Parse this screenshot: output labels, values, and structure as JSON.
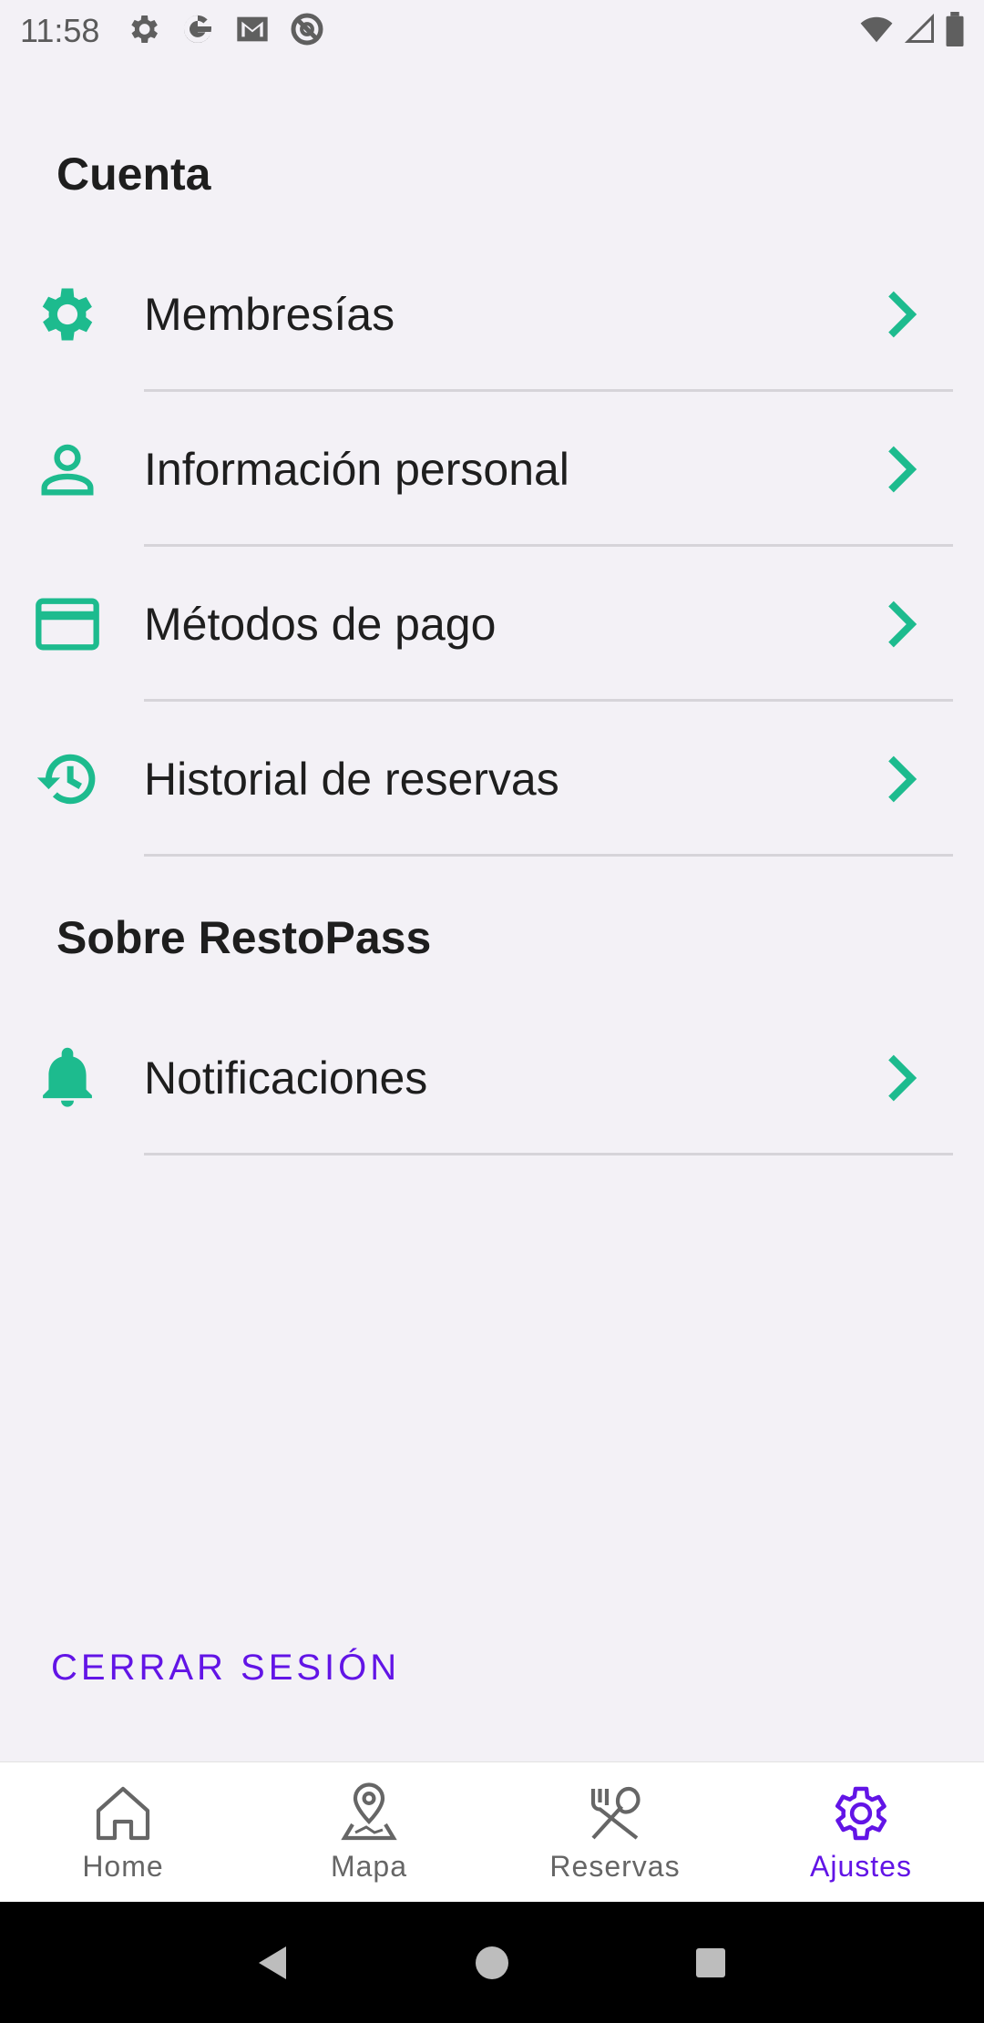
{
  "status_bar": {
    "time": "11:58",
    "left_icons": [
      "settings-icon",
      "google-icon",
      "gmail-icon",
      "at-sign-icon"
    ],
    "right_icons": [
      "wifi-icon",
      "signal-icon",
      "battery-icon"
    ]
  },
  "sections": {
    "account_title": "Cuenta",
    "about_title": "Sobre RestoPass"
  },
  "account_items": [
    {
      "label": "Membresías",
      "icon": "gear-icon"
    },
    {
      "label": "Información personal",
      "icon": "person-icon"
    },
    {
      "label": "Métodos de pago",
      "icon": "credit-card-icon"
    },
    {
      "label": "Historial de reservas",
      "icon": "history-icon"
    }
  ],
  "about_items": [
    {
      "label": "Notificaciones",
      "icon": "bell-icon"
    }
  ],
  "logout_label": "CERRAR SESIÓN",
  "bottom_nav": {
    "home": "Home",
    "map": "Mapa",
    "reservations": "Reservas",
    "settings": "Ajustes",
    "active": "settings"
  },
  "colors": {
    "accent_green": "#1dbb8e",
    "accent_purple": "#6214e6",
    "background": "#f3f1f6"
  }
}
